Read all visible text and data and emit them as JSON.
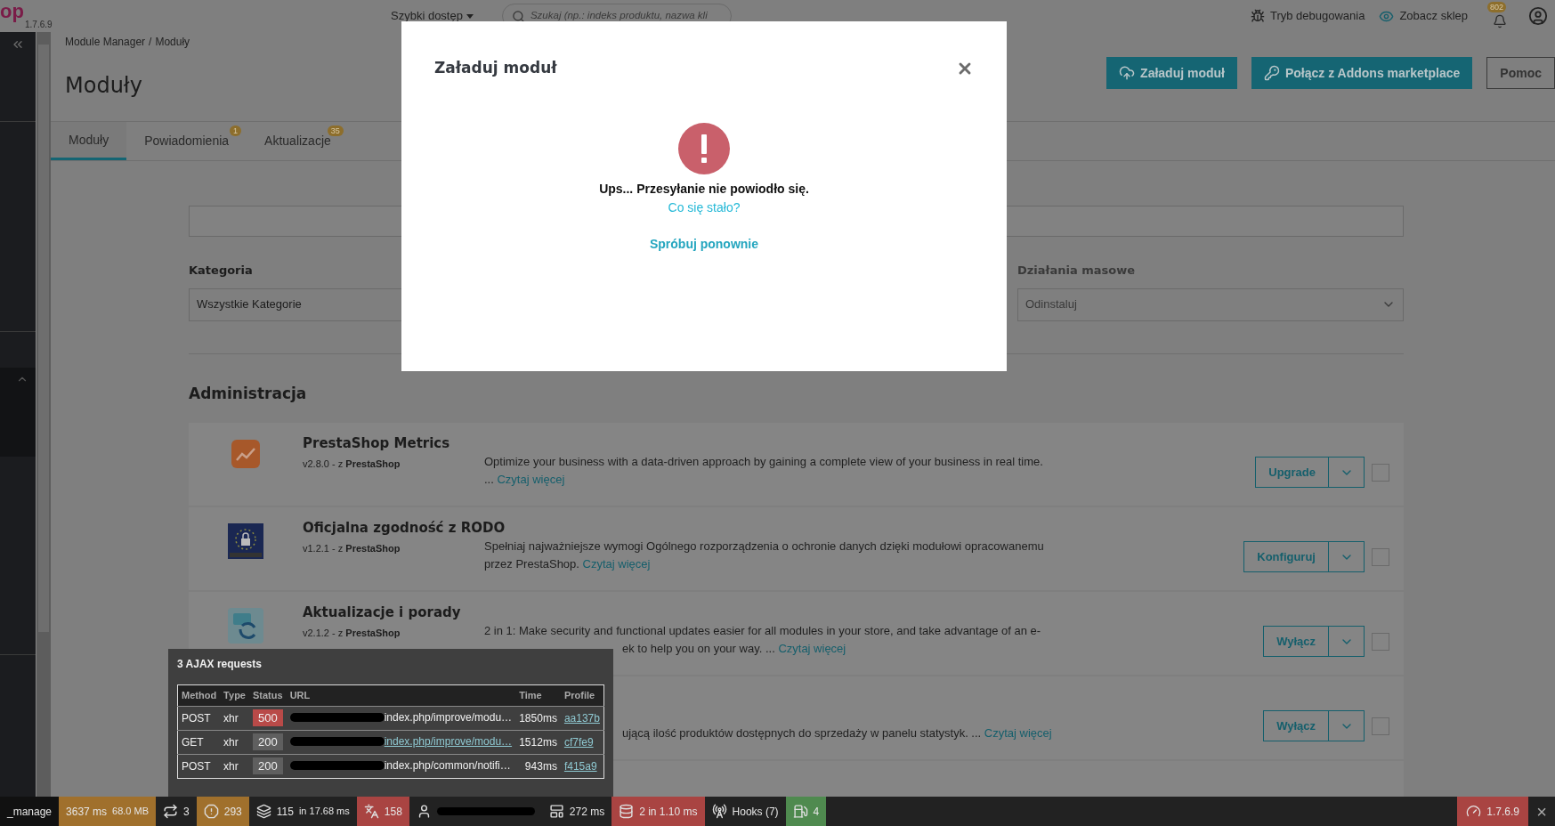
{
  "header": {
    "logo": "op",
    "version": "1.7.6.9",
    "quick_access": "Szybki dostęp",
    "search": {
      "placeholder": "Szukaj (np.: indeks produktu, nazwa kli"
    },
    "debug": "Tryb debugowania",
    "view_shop": "Zobacz sklep",
    "notifications": "802"
  },
  "breadcrumb": {
    "items": [
      "Module Manager",
      "Moduły"
    ],
    "separator": "/"
  },
  "title": "Moduły",
  "actions": [
    {
      "label": "Załaduj moduł",
      "kind": "upload"
    },
    {
      "label": "Połącz z Addons marketplace",
      "kind": "connect"
    },
    {
      "label": "Pomoc",
      "kind": "help"
    }
  ],
  "tabs": [
    {
      "label": "Moduły",
      "selected": true
    },
    {
      "label": "Powiadomienia",
      "selected": false,
      "badge": "1"
    },
    {
      "label": "Aktualizacje",
      "selected": false,
      "badge": "35"
    }
  ],
  "filters": {
    "category_label": "Kategoria",
    "category_value": "Wszystkie Kategorie",
    "bulk_label": "Działania masowe",
    "bulk_placeholder": "Odinstaluj"
  },
  "section": "Administracja",
  "modules": [
    {
      "kind": "metrics",
      "name": "PrestaShop Metrics",
      "version": "v2.8.0 - z **PrestaShop**",
      "lines": [
        {
          "text": "Optimize your business with a data-driven approach by gaining a complete view of your business in real time."
        },
        {
          "text": "..."
        }
      ],
      "link": "Czytaj więcej",
      "action": "Upgrade",
      "checked": false
    },
    {
      "kind": "rodo",
      "name": "Oficjalna zgodność z RODO",
      "version": "v1.2.1 - z **PrestaShop**",
      "lines": [
        {
          "text": "Spełniaj najważniejsze wymogi Ogólnego rozporządzenia o ochronie danych dzięki modułowi opracowanemu"
        },
        {
          "text": "przez PrestaShop."
        }
      ],
      "link": "Czytaj więcej",
      "action": "Konfiguruj",
      "checked": false
    },
    {
      "kind": "updates",
      "name": "Aktualizacje i porady",
      "version": "v2.1.2 - z **PrestaShop**",
      "lines": [
        {
          "text": "2 in 1: Make security and functional updates easier for all modules in your store, and take advantage of an e-"
        },
        {
          "text": "ek to help you on your way. ...",
          "covered": true
        }
      ],
      "link": "Czytaj więcej",
      "action": "Wyłącz",
      "checked": false
    },
    {
      "lines": [
        {
          "text": "ującą ilość produktów dostępnych do sprzedaży w panelu statystyk. ...",
          "covered": true
        }
      ],
      "link": "Czytaj więcej",
      "action": "Wyłącz",
      "checked": false
    }
  ],
  "modal": {
    "title": "Załaduj moduł",
    "message": "Ups... Przesyłanie nie powiodło się.",
    "help_link": "Co się stało?",
    "retry": "Spróbuj ponownie"
  },
  "ajax": {
    "title": "3 AJAX requests",
    "columns": [
      "Method",
      "Type",
      "Status",
      "URL",
      "Time",
      "Profile"
    ],
    "rows": [
      {
        "method": "POST",
        "type": "xhr",
        "status": "500",
        "color": "#b94a48",
        "url": "index.php/improve/modu…",
        "linked": false,
        "time": "1850ms",
        "profile": "aa137b"
      },
      {
        "method": "GET",
        "type": "xhr",
        "status": "200",
        "color": "#5f5f5f",
        "url": "index.php/improve/modu…",
        "linked": true,
        "time": "1512ms",
        "profile": "cf7fe9"
      },
      {
        "method": "POST",
        "type": "xhr",
        "status": "200",
        "color": "#5f5f5f",
        "url": "index.php/common/notifi…",
        "linked": false,
        "time": "943ms",
        "profile": "f415a9"
      }
    ]
  },
  "toolbar": {
    "segments": [
      {
        "kind": "text",
        "parts": [
          "_manage"
        ],
        "color": "#111111"
      },
      {
        "kind": "time",
        "parts": [
          "3637 ms",
          "68.0 MB"
        ],
        "color": "#a0702c"
      },
      {
        "kind": "route",
        "parts": [
          "3"
        ],
        "color": "#222222"
      },
      {
        "kind": "notice",
        "parts": [
          "293"
        ],
        "color": "#a0702c"
      },
      {
        "kind": "layers",
        "parts": [
          "115",
          "in 17.68 ms"
        ],
        "color": "#222222"
      },
      {
        "kind": "translation",
        "parts": [
          "158"
        ],
        "color": "#a94442"
      },
      {
        "kind": "user",
        "color": "#222222"
      },
      {
        "kind": "form",
        "parts": [
          "272 ms"
        ],
        "color": "#222222"
      },
      {
        "kind": "database",
        "parts": [
          "2 in 1.10 ms"
        ],
        "color": "#a94442"
      },
      {
        "kind": "hooks",
        "parts": [
          "Hooks (7)"
        ],
        "color": "#222222"
      },
      {
        "kind": "fuel",
        "parts": [
          "4"
        ],
        "color": "#4f8a4f"
      }
    ],
    "version": {
      "text": "1.7.6.9",
      "color": "#a94442"
    },
    "close": "×"
  }
}
